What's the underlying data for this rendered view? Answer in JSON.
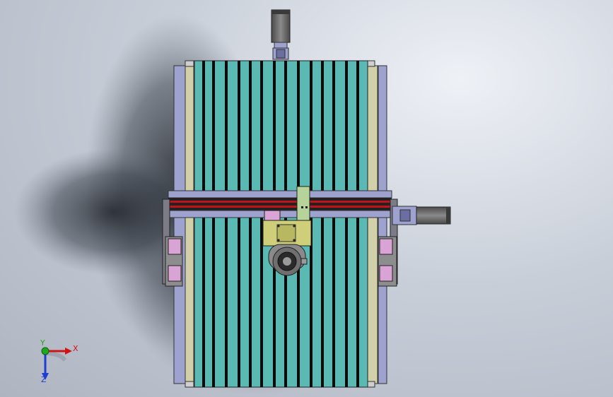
{
  "viewport": {
    "triad": {
      "x_label": "X",
      "y_label": "Y",
      "z_label": "Z"
    }
  },
  "colors": {
    "background_light": "#eef1f6",
    "background_dark": "#aeb5c1",
    "extrusion_teal": "#5bb9b4",
    "extrusion_slot": "#0b0b0b",
    "rail_lavender": "#9ea2cf",
    "rail_khaki": "#d2d0a8",
    "carriage_yellow": "#cfcf7a",
    "bracket_pink": "#d9a3d6",
    "motor_grey": "#6f6f6f",
    "rail_red": "#c0141c",
    "axis_x": "#d01414",
    "axis_y": "#1ea81e",
    "axis_z": "#1e3cd0"
  }
}
